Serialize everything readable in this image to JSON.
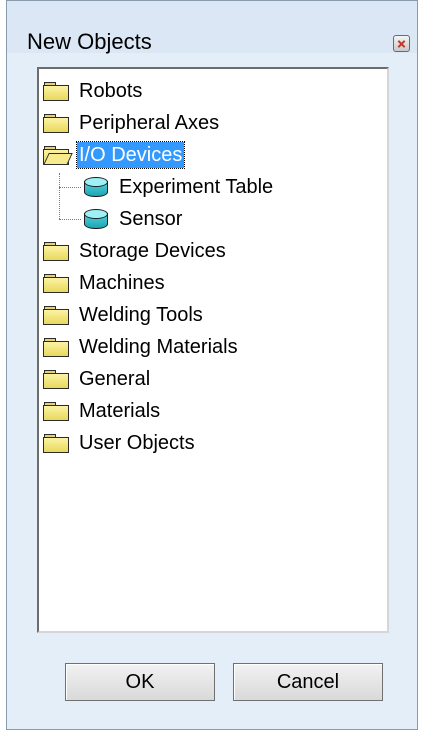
{
  "window": {
    "title": "New Objects"
  },
  "tree": {
    "items": [
      {
        "label": "Robots",
        "icon": "folder-icon"
      },
      {
        "label": "Peripheral Axes",
        "icon": "folder-icon"
      },
      {
        "label": "I/O Devices",
        "icon": "folder-open-icon",
        "selected": true,
        "expanded": true,
        "children": [
          {
            "label": "Experiment Table",
            "icon": "device-icon"
          },
          {
            "label": "Sensor",
            "icon": "device-icon"
          }
        ]
      },
      {
        "label": "Storage Devices",
        "icon": "folder-icon"
      },
      {
        "label": "Machines",
        "icon": "folder-icon"
      },
      {
        "label": "Welding Tools",
        "icon": "folder-icon"
      },
      {
        "label": "Welding Materials",
        "icon": "folder-icon"
      },
      {
        "label": "General",
        "icon": "folder-icon"
      },
      {
        "label": "Materials",
        "icon": "folder-icon"
      },
      {
        "label": "User Objects",
        "icon": "folder-icon"
      }
    ]
  },
  "buttons": {
    "ok_label": "OK",
    "cancel_label": "Cancel"
  },
  "colors": {
    "selection": "#3399ff",
    "window_bg": "#e4eef9"
  }
}
